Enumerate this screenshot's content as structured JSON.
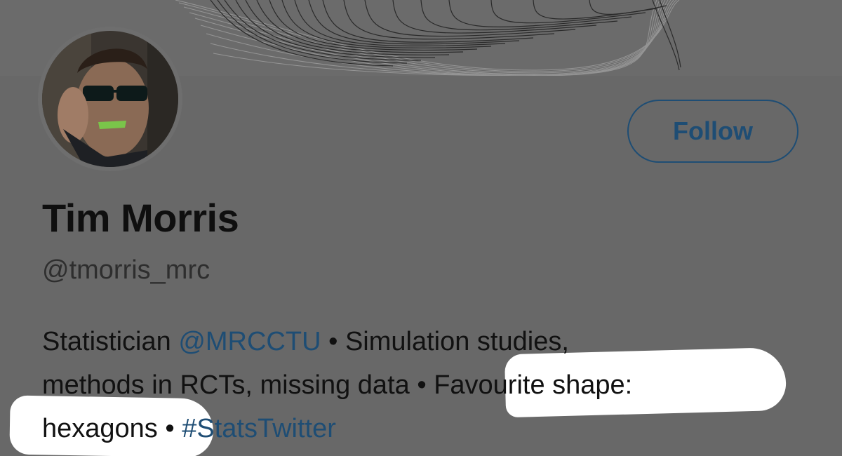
{
  "profile": {
    "name": "Tim Morris",
    "handle": "@tmorris_mrc",
    "follow_label": "Follow",
    "bio": {
      "line1_a": "Statistician ",
      "line1_mention": "@MRCCTU",
      "line1_b": " • Simulation studies,",
      "line2_a": "methods in RCTs, missing data ",
      "line2_b": "• Favourite shape:",
      "line3_a": "hexagons",
      "line3_b": " • ",
      "line3_hashtag": "#StatsTwitter"
    }
  },
  "colors": {
    "background": "#686868",
    "link": "#1e4d74",
    "text": "#111111",
    "highlight": "#ffffff"
  },
  "icons": {
    "banner": "hexagon-wave-banner",
    "avatar": "profile-photo"
  }
}
